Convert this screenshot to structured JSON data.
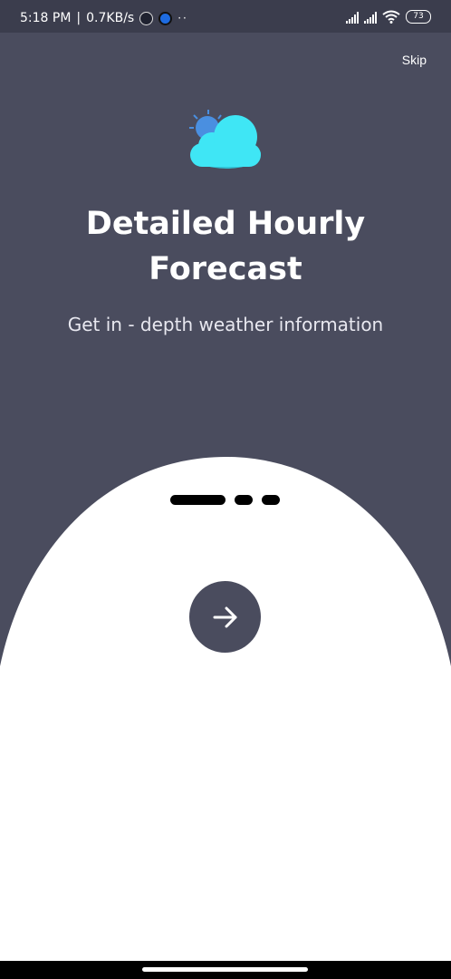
{
  "status_bar": {
    "time": "5:18 PM",
    "separator": "|",
    "network_speed": "0.7KB/s",
    "more_indicator": "··",
    "battery": "73",
    "icons": [
      "whatsapp-icon",
      "messenger-icon",
      "signal-icon",
      "signal-icon",
      "wifi-icon",
      "battery-icon"
    ]
  },
  "header": {
    "skip_label": "Skip"
  },
  "onboarding": {
    "icon": "partly-cloudy-icon",
    "title": "Detailed Hourly Forecast",
    "subtitle": "Get in - depth weather information",
    "page_indicator": {
      "total": 3,
      "active": 1
    },
    "next_icon": "arrow-right-icon"
  },
  "colors": {
    "background": "#4a4c5e",
    "status_bar": "#3b3d4d",
    "panel": "#ffffff",
    "cloud": "#3fe6f5",
    "sun": "#4a8fe0",
    "button": "#4a4c5e"
  }
}
